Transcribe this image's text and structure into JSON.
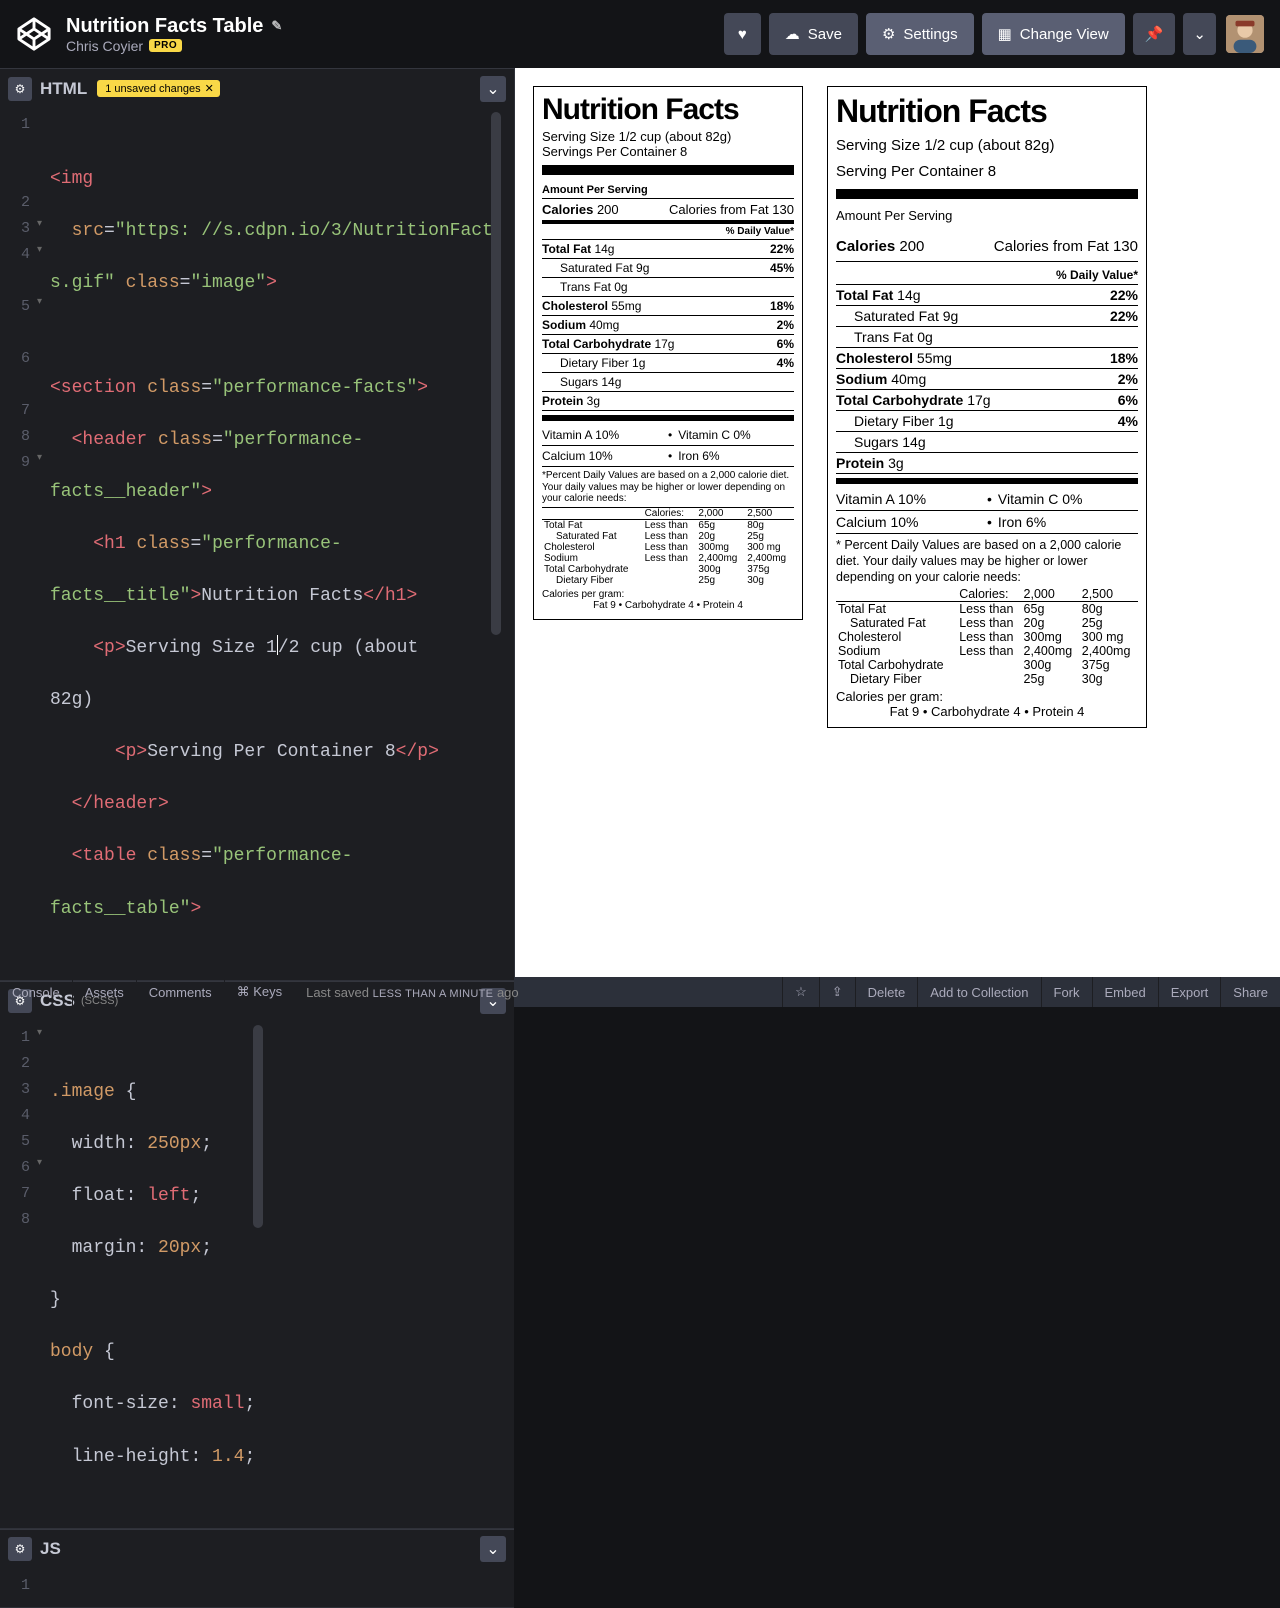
{
  "header": {
    "pen_title": "Nutrition Facts Table",
    "author": "Chris Coyier",
    "pro_badge": "PRO",
    "buttons": {
      "save": "Save",
      "settings": "Settings",
      "change_view": "Change View"
    }
  },
  "editors": {
    "html": {
      "label": "HTML",
      "unsaved_text": "1 unsaved changes",
      "lines": [
        "<img",
        "  src=\"https: //s.cdpn.io/3/NutritionFacts.gif\" class=\"image\">",
        "",
        "<section class=\"performance-facts\">",
        "  <header class=\"performance-facts__header\">",
        "    <h1 class=\"performance-facts__title\">Nutrition Facts</h1>",
        "    <p>Serving Size 1/2 cup (about 82g)",
        "      <p>Serving Per Container 8</p>",
        "  </header>",
        "  <table class=\"performance-facts__table\">"
      ]
    },
    "css": {
      "label": "CSS",
      "sublabel": "(SCSS)",
      "lines": [
        ".image {",
        "  width: 250px;",
        "  float: left;",
        "  margin: 20px;",
        "}",
        "body {",
        "  font-size: small;",
        "  line-height: 1.4;"
      ]
    },
    "js": {
      "label": "JS"
    }
  },
  "nutrition": {
    "title": "Nutrition Facts",
    "serving_size": "Serving Size 1/2 cup (about 82g)",
    "servings_per_a": "Servings Per Container 8",
    "servings_per_b": "Serving Per Container 8",
    "amount_per_serving": "Amount Per Serving",
    "calories_label": "Calories",
    "calories": "200",
    "calories_fat_label": "Calories from Fat",
    "calories_fat": "130",
    "daily_value": "% Daily Value*",
    "rows": [
      {
        "label": "Total Fat",
        "val": "14g",
        "pct": "22%",
        "bold": true
      },
      {
        "label": "Saturated Fat",
        "val": "9g",
        "pct_a": "45%",
        "pct_b": "22%",
        "sub": true
      },
      {
        "label": "Trans Fat",
        "val": "0g",
        "pct": "",
        "sub": true
      },
      {
        "label": "Cholesterol",
        "val": "55mg",
        "pct": "18%",
        "bold": true
      },
      {
        "label": "Sodium",
        "val": "40mg",
        "pct": "2%",
        "bold": true
      },
      {
        "label": "Total Carbohydrate",
        "val": "17g",
        "pct": "6%",
        "bold": true
      },
      {
        "label": "Dietary Fiber",
        "val": "1g",
        "pct": "4%",
        "sub": true
      },
      {
        "label": "Sugars",
        "val": "14g",
        "pct": "",
        "sub": true
      },
      {
        "label": "Protein",
        "val": "3g",
        "pct": "",
        "bold": true
      }
    ],
    "vitamins": [
      [
        "Vitamin A 10%",
        "Vitamin C 0%"
      ],
      [
        "Calcium 10%",
        "Iron 6%"
      ]
    ],
    "footnote_a": "*Percent Daily Values are based on a 2,000 calorie diet. Your daily values may be higher or lower depending on your calorie needs:",
    "footnote_b": "* Percent Daily Values are based on a 2,000 calorie diet. Your daily values may be higher or lower depending on your calorie needs:",
    "needs_header": [
      "Calories:",
      "2,000",
      "2,500"
    ],
    "needs": [
      [
        "Total Fat",
        "Less than",
        "65g",
        "80g"
      ],
      [
        "Saturated Fat",
        "Less than",
        "20g",
        "25g"
      ],
      [
        "Cholesterol",
        "Less than",
        "300mg",
        "300 mg"
      ],
      [
        "Sodium",
        "Less than",
        "2,400mg",
        "2,400mg"
      ],
      [
        "Total Carbohydrate",
        "",
        "300g",
        "375g"
      ],
      [
        "Dietary Fiber",
        "",
        "25g",
        "30g"
      ]
    ],
    "cal_per_gram_label": "Calories per gram:",
    "cal_per_gram_a": "Fat 9  •  Carbohydrate 4  •  Protein 4",
    "cal_per_gram_b": "Fat 9 • Carbohydrate 4 • Protein 4"
  },
  "footer": {
    "left": [
      "Console",
      "Assets",
      "Comments",
      "⌘ Keys"
    ],
    "saved_prefix": "Last saved ",
    "saved_time": "less than a minute",
    "saved_suffix": " ago",
    "right": [
      "Delete",
      "Add to Collection",
      "Fork",
      "Embed",
      "Export",
      "Share"
    ]
  }
}
